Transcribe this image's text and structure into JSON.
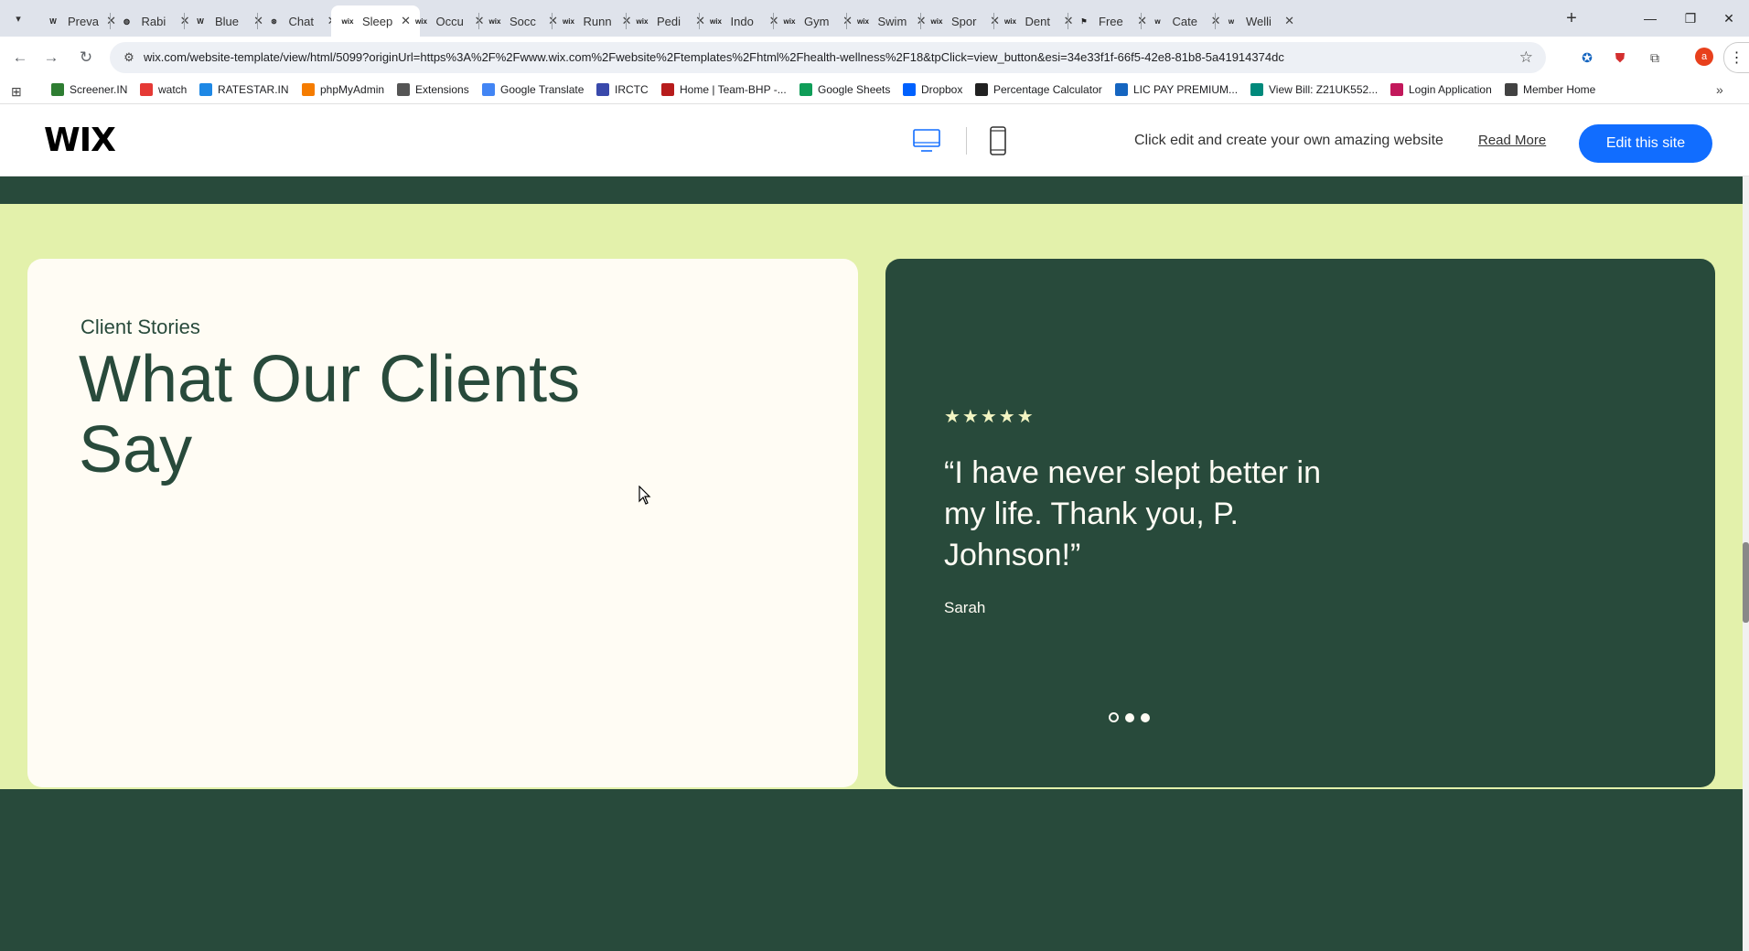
{
  "browser": {
    "tabs": [
      {
        "favicon": "W",
        "title": "Preva"
      },
      {
        "favicon": "◍",
        "title": "Rabi"
      },
      {
        "favicon": "W",
        "title": "Blue"
      },
      {
        "favicon": "⊛",
        "title": "Chat"
      },
      {
        "favicon": "wix",
        "title": "Sleep",
        "active": true
      },
      {
        "favicon": "wix",
        "title": "Occu"
      },
      {
        "favicon": "wix",
        "title": "Socc"
      },
      {
        "favicon": "wix",
        "title": "Runn"
      },
      {
        "favicon": "wix",
        "title": "Pedi"
      },
      {
        "favicon": "wix",
        "title": "Indo"
      },
      {
        "favicon": "wix",
        "title": "Gym"
      },
      {
        "favicon": "wix",
        "title": "Swim"
      },
      {
        "favicon": "wix",
        "title": "Spor"
      },
      {
        "favicon": "wix",
        "title": "Dent"
      },
      {
        "favicon": "⚑",
        "title": "Free"
      },
      {
        "favicon": "w",
        "title": "Cate"
      },
      {
        "favicon": "w",
        "title": "Welli"
      }
    ],
    "url": "wix.com/website-template/view/html/5099?originUrl=https%3A%2F%2Fwww.wix.com%2Fwebsite%2Ftemplates%2Fhtml%2Fhealth-wellness%2F18&tpClick=view_button&esi=34e33f1f-66f5-42e8-81b8-5a41914374dc",
    "profile_initial": "a",
    "bookmarks": [
      {
        "label": "Screener.IN",
        "color": "#2e7d32"
      },
      {
        "label": "watch",
        "color": "#e53935"
      },
      {
        "label": "RATESTAR.IN",
        "color": "#1e88e5"
      },
      {
        "label": "phpMyAdmin",
        "color": "#f57c00"
      },
      {
        "label": "Extensions",
        "color": "#555555"
      },
      {
        "label": "Google Translate",
        "color": "#4285f4"
      },
      {
        "label": "IRCTC",
        "color": "#3949ab"
      },
      {
        "label": "Home | Team-BHP -...",
        "color": "#b71c1c"
      },
      {
        "label": "Google Sheets",
        "color": "#0f9d58"
      },
      {
        "label": "Dropbox",
        "color": "#0061fe"
      },
      {
        "label": "Percentage Calculator",
        "color": "#212121"
      },
      {
        "label": "LIC PAY PREMIUM...",
        "color": "#1565c0"
      },
      {
        "label": "View Bill: Z21UK552...",
        "color": "#00897b"
      },
      {
        "label": "Login Application",
        "color": "#c2185b"
      },
      {
        "label": "Member Home",
        "color": "#424242"
      }
    ]
  },
  "wix_header": {
    "logo": "WIX",
    "promo_text": "Click edit and create your own amazing website",
    "read_more": "Read More",
    "edit_button": "Edit this site"
  },
  "testimonials": {
    "eyebrow": "Client Stories",
    "heading": "What Our Clients Say",
    "stars": "★★★★★",
    "rating": 5,
    "quote": "“I have never slept better in my life. Thank you, P. Johnson!”",
    "author": "Sarah",
    "slide_count": 3,
    "active_slide": 1
  },
  "colors": {
    "dark_green": "#284a3b",
    "lime": "#e3f1ab",
    "cream": "#fffcf4",
    "wix_blue": "#116dff"
  }
}
